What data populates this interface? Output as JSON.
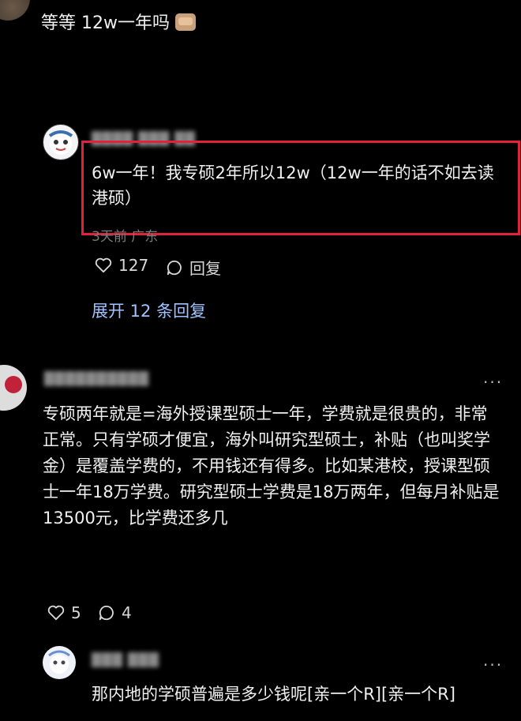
{
  "colors": {
    "background": "#000000",
    "text": "#f0f0f0",
    "link": "#9fc3ff",
    "meta": "#7a7a7a",
    "highlight_border": "#e0233a"
  },
  "top_comment": {
    "text": "等等 12w一年吗",
    "emoji": "face-palm-emoji"
  },
  "reply_1": {
    "username_blurred": "████ ███ ██",
    "text": "6w一年！我专硕2年所以12w（12w一年的话不如去读港硕）",
    "time_location": "3天前 广东",
    "likes": "127",
    "reply_label": "回复"
  },
  "expand_replies": "展开 12 条回复",
  "comment_2": {
    "username_blurred": "██████████",
    "text": "专硕两年就是=海外授课型硕士一年，学费就是很贵的，非常正常。只有学硕才便宜，海外叫研究型硕士，补贴（也叫奖学金）是覆盖学费的，不用钱还有得多。比如某港校，授课型硕士一年18万学费。研究型硕士学费是18万两年，但每月补贴是13500元，比学费还多几",
    "likes": "5",
    "comments": "4",
    "more": "..."
  },
  "reply_2": {
    "username_blurred": "███ ███",
    "text": "那内地的学硕普遍是多少钱呢[亲一个R][亲一个R]",
    "more": "..."
  }
}
